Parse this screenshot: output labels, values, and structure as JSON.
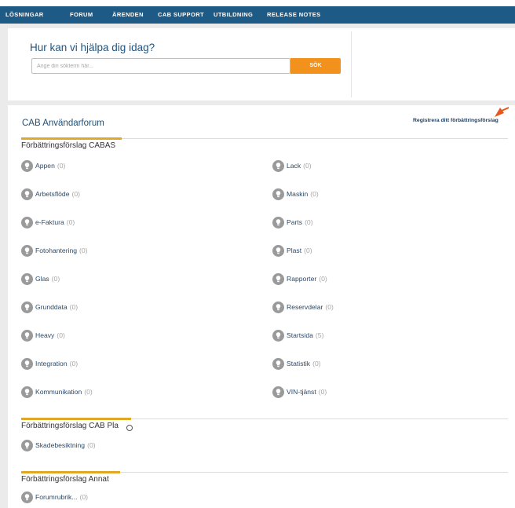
{
  "nav": {
    "items": [
      {
        "label": "LÖSNINGAR"
      },
      {
        "label": "FORUM"
      },
      {
        "label": "ÄRENDEN"
      },
      {
        "label": "CAB SUPPORT"
      },
      {
        "label": "UTBILDNING"
      },
      {
        "label": "RELEASE NOTES"
      }
    ]
  },
  "search": {
    "title": "Hur kan vi hjälpa dig idag?",
    "placeholder": "Ange din sökterm här...",
    "value": "",
    "button_label": "SÖK"
  },
  "forum": {
    "title": "CAB Användarforum",
    "register_label": "Registrera ditt förbättringsförslag",
    "sections": [
      {
        "title": "Förbättringsförslag CABAS",
        "left_items": [
          {
            "name": "Appen",
            "count": "(0)"
          },
          {
            "name": "Arbetsflöde",
            "count": "(0)"
          },
          {
            "name": "e-Faktura",
            "count": "(0)"
          },
          {
            "name": "Fotohantering",
            "count": "(0)"
          },
          {
            "name": "Glas",
            "count": "(0)"
          },
          {
            "name": "Grunddata",
            "count": "(0)"
          },
          {
            "name": "Heavy",
            "count": "(0)"
          },
          {
            "name": "Integration",
            "count": "(0)"
          },
          {
            "name": "Kommunikation",
            "count": "(0)"
          }
        ],
        "right_items": [
          {
            "name": "Lack",
            "count": "(0)"
          },
          {
            "name": "Maskin",
            "count": "(0)"
          },
          {
            "name": "Parts",
            "count": "(0)"
          },
          {
            "name": "Plast",
            "count": "(0)"
          },
          {
            "name": "Rapporter",
            "count": "(0)"
          },
          {
            "name": "Reservdelar",
            "count": "(0)"
          },
          {
            "name": "Startsida",
            "count": "(5)"
          },
          {
            "name": "Statistik",
            "count": "(0)"
          },
          {
            "name": "VIN-tjänst",
            "count": "(0)"
          }
        ]
      },
      {
        "title": "Förbättringsförslag CAB Pla",
        "left_items": [
          {
            "name": "Skadebesiktning",
            "count": "(0)"
          }
        ]
      },
      {
        "title": "Förbättringsförslag Annat",
        "left_items": [
          {
            "name": "Forumrubrik...",
            "count": "(0)"
          }
        ]
      }
    ]
  },
  "colors": {
    "navbar": "#1d5a86",
    "accent_orange": "#f2911b",
    "section_rule": "#e1a828",
    "link": "#2a4b6b",
    "icon_gray": "#9a9a9a",
    "arrow": "#e8561c"
  },
  "icons": {
    "category": "lightbulb-icon",
    "pointer": "arrow-icon"
  }
}
